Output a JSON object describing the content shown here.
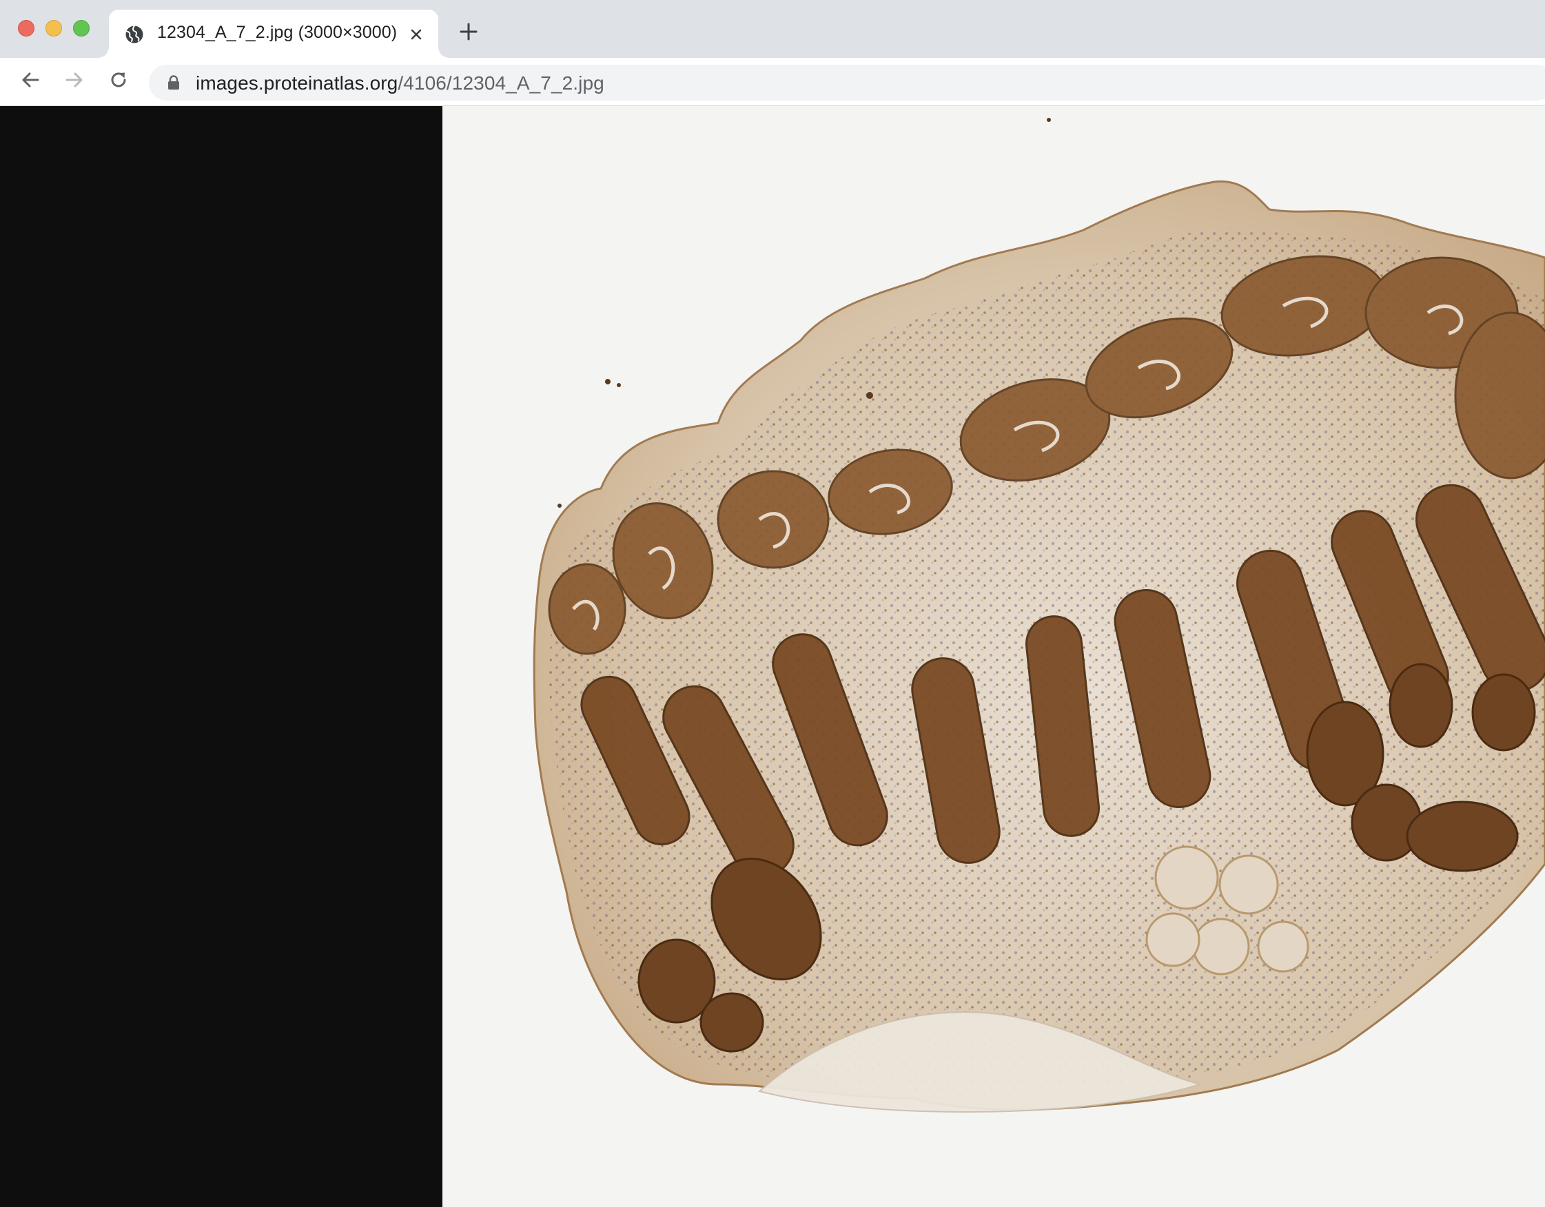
{
  "window": {
    "controls": [
      "close",
      "minimize",
      "maximize"
    ]
  },
  "tab": {
    "title": "12304_A_7_2.jpg (3000×3000)",
    "favicon": "globe-icon",
    "close_icon": "close-icon"
  },
  "new_tab_icon": "plus-icon",
  "toolbar": {
    "back_icon": "arrow-left-icon",
    "forward_icon": "arrow-right-icon",
    "reload_icon": "reload-icon",
    "lock_icon": "lock-icon",
    "url_host": "images.proteinatlas.org",
    "url_path": "/4106/12304_A_7_2.jpg"
  },
  "content": {
    "background": "#0e0e0e",
    "image_background": "#f4f4f3",
    "stain_colors": [
      "#8a5a30",
      "#6e4423",
      "#b78a5c",
      "#c9a784"
    ],
    "counterstain_color": "#8a8fb4"
  }
}
